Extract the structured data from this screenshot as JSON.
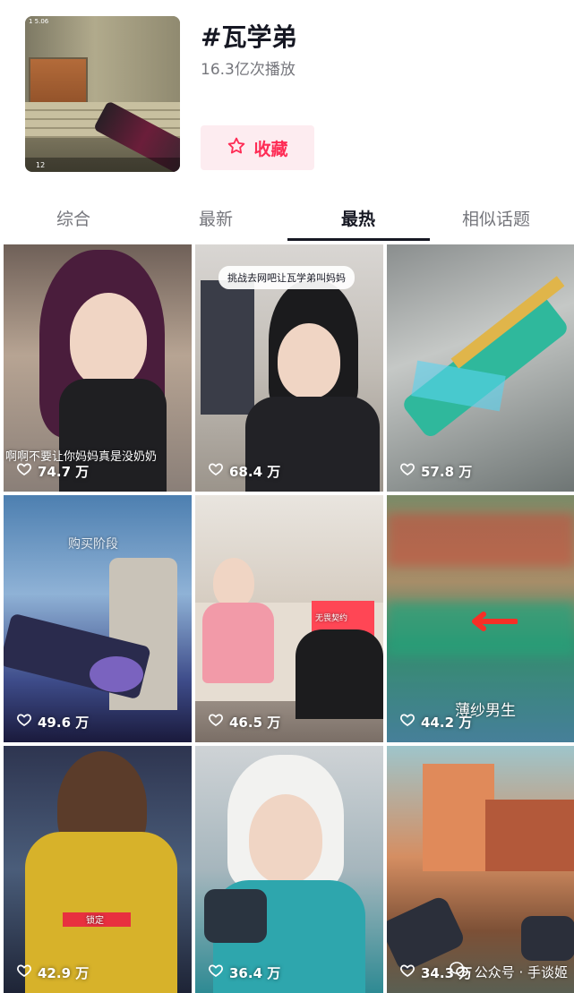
{
  "header": {
    "title": "#瓦学弟",
    "play_count": "16.3亿次播放",
    "collect_label": "收藏",
    "accent_color": "#fe2c55",
    "cover_hud_top": "1  5.06",
    "cover_hud_ammo": "12"
  },
  "tabs": [
    {
      "label": "综合",
      "active": false
    },
    {
      "label": "最新",
      "active": false
    },
    {
      "label": "最热",
      "active": true
    },
    {
      "label": "相似话题",
      "active": false
    }
  ],
  "videos": [
    {
      "likes": "74.7 万",
      "overlay": "啊啊不要让你妈妈真是没奶奶"
    },
    {
      "likes": "68.4 万",
      "overlay": "挑战去网吧让瓦学弟叫妈妈"
    },
    {
      "likes": "57.8 万",
      "overlay": ""
    },
    {
      "likes": "49.6 万",
      "overlay": "购买阶段"
    },
    {
      "likes": "46.5 万",
      "overlay": "无畏契约"
    },
    {
      "likes": "44.2 万",
      "overlay": "薄纱男生"
    },
    {
      "likes": "42.9 万",
      "overlay": "锁定"
    },
    {
      "likes": "36.4 万",
      "overlay": ""
    },
    {
      "likes": "34.3 万",
      "overlay": ""
    }
  ],
  "watermark": "公众号 · 手谈姬",
  "icons": {
    "collect": "star-outline-icon",
    "like": "heart-outline-icon",
    "watermark": "wechat-icon"
  }
}
